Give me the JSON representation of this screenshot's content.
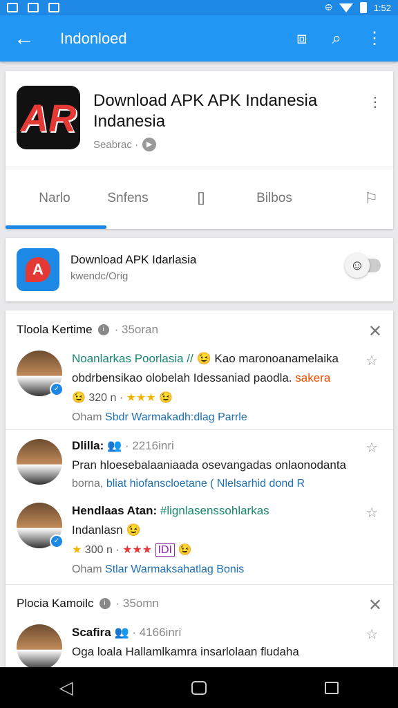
{
  "status": {
    "left_icons": [
      "image-icon",
      "gallery-icon",
      "photo-icon"
    ],
    "indicators": "⨸",
    "time": "1:52"
  },
  "app_bar": {
    "title": "Indonloed",
    "back_icon": "←",
    "cast_icon": "⧈",
    "search_icon": "⌕",
    "more_icon": "⋮"
  },
  "app": {
    "title": "Download APK APK Indanesia Indanesia",
    "meta": "Seabrac ·",
    "play_icon": "▶",
    "more_icon": "⋮",
    "icon_glyph": "AR",
    "tabs": [
      "Narlo",
      "Snfens",
      "[]",
      "Bilbos"
    ],
    "bookmark_icon": "⚐"
  },
  "promo": {
    "title": "Download APK Idarlasia",
    "subtitle": "kwendc/Orig",
    "toggle_emoji": "☺"
  },
  "feed": {
    "section1": {
      "title": "Tloola Kertime",
      "time": "· 35oran",
      "close": "✕"
    },
    "post1": {
      "link_text": "Noanlarkas Poorlasia //",
      "emoji1": "😉",
      "body": " Kao maronoanamelaika obdrbensikao olobelah Idessaniad paodla.",
      "tag": "sakera",
      "count": "320 n ·",
      "stars": "★★★",
      "emoji2": "😉",
      "link_prefix": "Oham",
      "link": "Sbdr Warmakadh:dlag Parrle",
      "pin": "☆"
    },
    "post2": {
      "author": "Dlilla:",
      "badge": "👥",
      "time": "· 2216inri",
      "body": "Pran hloesebalaaniaada osevangadas onlaonodanta",
      "link_prefix": "borna,",
      "link": "bliat hiofanscloetane ( Nlelsarhid dond R",
      "pin": "☆"
    },
    "post3": {
      "author": "Hendlaas Atan:",
      "hashtag": "#lignlasenssohlarkas",
      "body": "Indanlasn",
      "emoji1": "😉",
      "count": "300 n ·",
      "stars": "★★★",
      "label": "IDI",
      "emoji2": "😉",
      "link_prefix": "Oham",
      "link": "Stlar Warmaksahatlag Bonis",
      "pin": "☆"
    },
    "section2": {
      "title": "Plocia Kamoilc",
      "time": "· 35omn",
      "close": "✕"
    },
    "post4": {
      "author": "Scafira",
      "badge": "👥",
      "time": "· 4166inri",
      "body": "Oga loala Hallamlkamra insarlolaan fludaha",
      "pin": "☆"
    }
  },
  "nav": {
    "back": "◁"
  }
}
